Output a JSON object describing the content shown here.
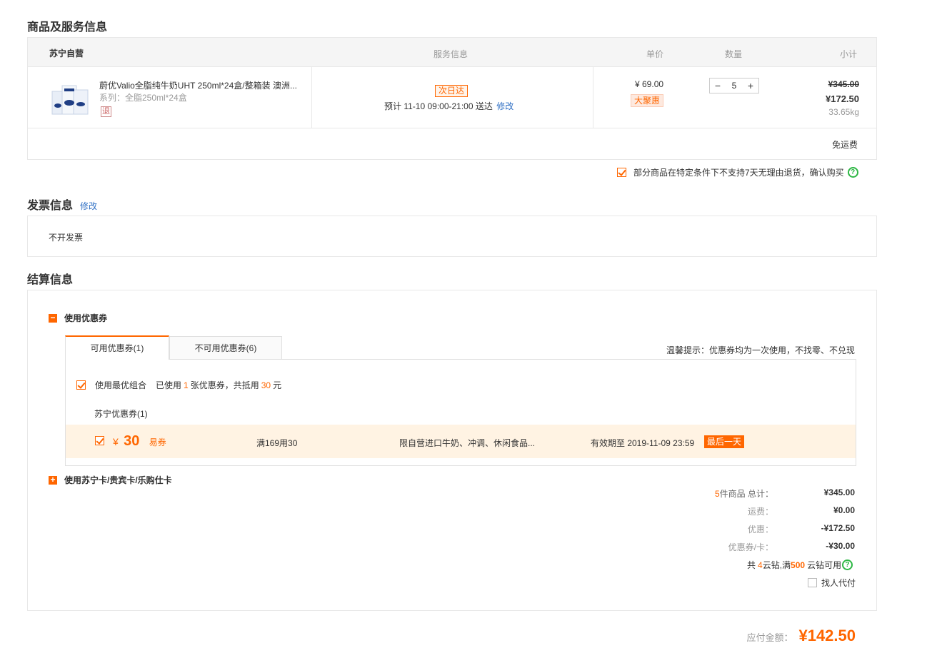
{
  "goods_section": {
    "title": "商品及服务信息",
    "header": {
      "store": "苏宁自营",
      "service": "服务信息",
      "unit_price": "单价",
      "quantity": "数量",
      "subtotal": "小计"
    },
    "item": {
      "name": "蔚优Valio全脂纯牛奶UHT 250ml*24盒/整箱装 澳洲...",
      "spec": "系列：全脂250ml*24盒",
      "return_tag": "退",
      "delivery_badge": "次日达",
      "delivery_text": "预计 11-10 09:00-21:00  送达",
      "delivery_modify": "修改",
      "price": "¥ 69.00",
      "promo_tag": "大聚惠",
      "qty": "5",
      "minus": "−",
      "plus": "+",
      "original_total": "¥345.00",
      "total": "¥172.50",
      "weight": "33.65kg"
    },
    "shipping": "免运费",
    "agree_text": "部分商品在特定条件下不支持7天无理由退货，确认购买"
  },
  "invoice_section": {
    "title": "发票信息",
    "modify": "修改",
    "value": "不开发票"
  },
  "settle_section": {
    "title": "结算信息",
    "coupon_toggle": "使用优惠券",
    "tabs": [
      {
        "label": "可用优惠券(1)"
      },
      {
        "label": "不可用优惠券(6)"
      }
    ],
    "tip": "温馨提示：优惠券均为一次使用，不找零、不兑现",
    "best_combo_label": "使用最优组合",
    "used_prefix": "已使用",
    "used_count": "1",
    "used_middle": "张优惠券，共抵用",
    "used_amount": "30",
    "used_suffix": "元",
    "group_label": "苏宁优惠券(1)",
    "coupon": {
      "currency": "¥",
      "amount": "30",
      "type": "易券",
      "condition": "满169用30",
      "scope": "限自营进口牛奶、冲调、休闲食品...",
      "expiry": "有效期至 2019-11-09 23:59",
      "badge": "最后一天"
    },
    "card_toggle": "使用苏宁卡/贵宾卡/乐购仕卡",
    "summary": {
      "count": "5",
      "count_suffix": "件商品 总计：",
      "total": "¥345.00",
      "freight_label": "运费：",
      "freight": "¥0.00",
      "discount_label": "优惠：",
      "discount": "-¥172.50",
      "coupon_label": "优惠券/卡：",
      "coupon_value": "-¥30.00",
      "diamond_prefix": "共",
      "diamond_count": "4",
      "diamond_middle": "云钻,满",
      "diamond_min": "500",
      "diamond_suffix": "云钻可用",
      "proxy_pay": "找人代付"
    }
  },
  "payable": {
    "label": "应付金额：",
    "amount": "¥142.50"
  },
  "colors": {
    "accent": "#ff6600",
    "link": "#2e6fc4",
    "help": "#2db744",
    "coupon_bg": "#fff3e3"
  }
}
